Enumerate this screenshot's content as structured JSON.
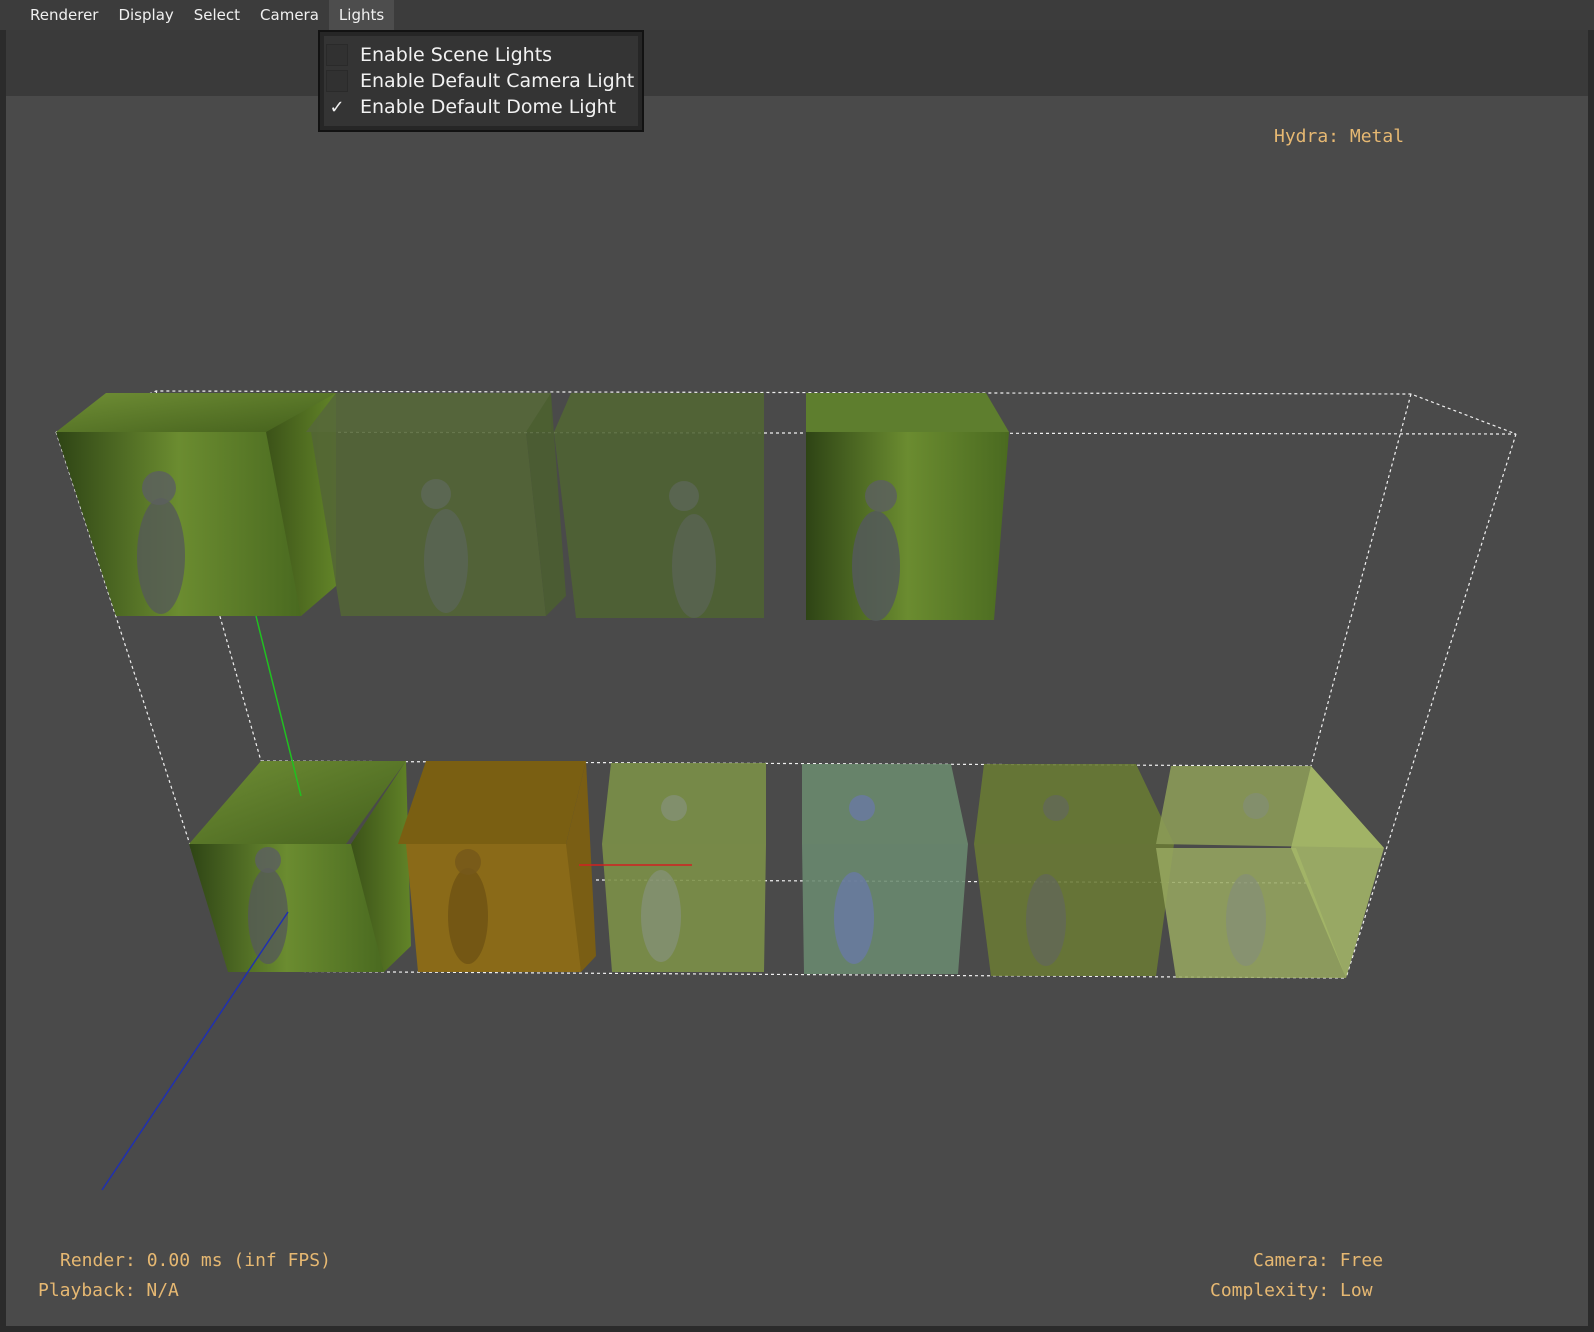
{
  "menubar": {
    "items": [
      "Renderer",
      "Display",
      "Select",
      "Camera",
      "Lights"
    ],
    "active": "Lights"
  },
  "lights_menu": {
    "items": [
      {
        "label": "Enable Scene Lights",
        "checked": false
      },
      {
        "label": "Enable Default Camera Light",
        "checked": false
      },
      {
        "label": "Enable Default Dome Light",
        "checked": true
      }
    ],
    "check_glyph": "✓"
  },
  "hud": {
    "renderer": "Hydra: Metal",
    "render_stats": "Render: 0.00 ms (inf FPS)",
    "playback": "Playback: N/A",
    "camera": "Camera: Free",
    "complexity": "Complexity: Low"
  },
  "colors": {
    "hud_text": "#e6b872",
    "viewport_bg": "#4a4a4a",
    "axis_x": "#d22020",
    "axis_y": "#20c020",
    "axis_z": "#2030b0"
  },
  "scene": {
    "cubes": [
      {
        "name": "cube-top-1",
        "tint": "#5a7a2a"
      },
      {
        "name": "cube-top-2",
        "tint": "#5b6b38"
      },
      {
        "name": "cube-top-3",
        "tint": "#566a34"
      },
      {
        "name": "cube-top-4",
        "tint": "#5c7a2e"
      },
      {
        "name": "cube-bottom-1",
        "tint": "#62802a"
      },
      {
        "name": "cube-bottom-2",
        "tint": "#8a6a18"
      },
      {
        "name": "cube-bottom-3",
        "tint": "#7c9048"
      },
      {
        "name": "cube-bottom-4",
        "tint": "#6a8a70"
      },
      {
        "name": "cube-bottom-5",
        "tint": "#6a7a34"
      },
      {
        "name": "cube-bottom-6",
        "tint": "#98a860"
      }
    ]
  }
}
